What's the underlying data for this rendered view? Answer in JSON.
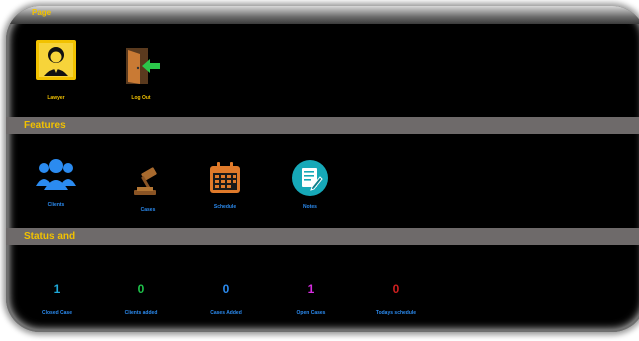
{
  "top": {
    "title": "Page"
  },
  "home": {
    "tiles": [
      {
        "label": "Lawyer",
        "icon": "lawyer-avatar-icon",
        "color": "#f2c200"
      },
      {
        "label": "Log Out",
        "icon": "logout-door-icon",
        "color": "#f2c200"
      }
    ]
  },
  "features": {
    "title": "Features",
    "tiles": [
      {
        "label": "Clients",
        "icon": "users-icon",
        "color": "#2b8bf0"
      },
      {
        "label": "Cases",
        "icon": "gavel-icon",
        "color": "#2b8bf0"
      },
      {
        "label": "Schedule",
        "icon": "calendar-icon",
        "color": "#2b8bf0"
      },
      {
        "label": "Notes",
        "icon": "notes-icon",
        "color": "#2b8bf0"
      }
    ]
  },
  "status": {
    "title": "Status and",
    "items": [
      {
        "value": "1",
        "label": "Closed Case",
        "color": "#1ea8d8"
      },
      {
        "value": "0",
        "label": "Clients added",
        "color": "#1ec24a"
      },
      {
        "value": "0",
        "label": "Cases Added",
        "color": "#2b8bf0"
      },
      {
        "value": "1",
        "label": "Open Cases",
        "color": "#d62ce0"
      },
      {
        "value": "0",
        "label": "Todays schedule",
        "color": "#d02020"
      }
    ]
  }
}
